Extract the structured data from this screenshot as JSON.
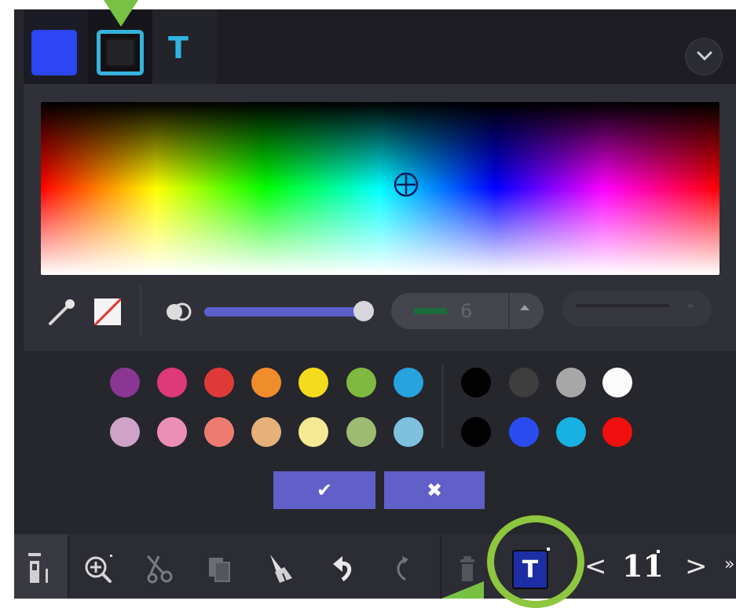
{
  "tabs": [
    {
      "name": "fill-color",
      "color": "#2b46f2"
    },
    {
      "name": "stroke-color",
      "border_color": "#35b3dc"
    },
    {
      "name": "text-color",
      "label": "T",
      "color": "#2fb4e0"
    }
  ],
  "picker": {
    "eyedropper_icon": "eyedropper-icon",
    "no_color_icon": "no-color-icon",
    "opacity_icon": "opacity-icon",
    "opacity_value": 1.0,
    "stroke_width": "6",
    "stroke_color": "#1b6b3b",
    "slider_color": "#5b5fc9"
  },
  "palette": {
    "colors_row1": [
      "#8a3793",
      "#de3a78",
      "#e03a38",
      "#ef8d2c",
      "#f4db1c",
      "#7fb941",
      "#27a3de"
    ],
    "colors_row2": [
      "#cfa3c8",
      "#ec8fb6",
      "#ee7b6f",
      "#e6b07b",
      "#f5e993",
      "#9dbb72",
      "#7ec1de"
    ],
    "grays_row1": [
      "#020202",
      "#3e3e3e",
      "#a7a7a7",
      "#fcfcfc"
    ],
    "grays_row2": [
      "#020202",
      "#2a4bef",
      "#18b1e2",
      "#f00f0f"
    ]
  },
  "actions": {
    "confirm_label": "✔",
    "cancel_label": "✖",
    "accent": "#6160c8"
  },
  "toolbar": {
    "items": [
      "layers-icon",
      "zoom-in-icon",
      "cut-icon",
      "copy-icon",
      "paint-brush-icon",
      "undo-icon",
      "redo-icon",
      "trash-icon",
      "text-tool-icon"
    ],
    "text_tool_label": "T",
    "prev_label": "<",
    "next_label": ">",
    "page_number": "11",
    "more_label": "»"
  },
  "annotations": {
    "highlight_color": "#8dc63f",
    "arrow_color": "#78c143"
  }
}
